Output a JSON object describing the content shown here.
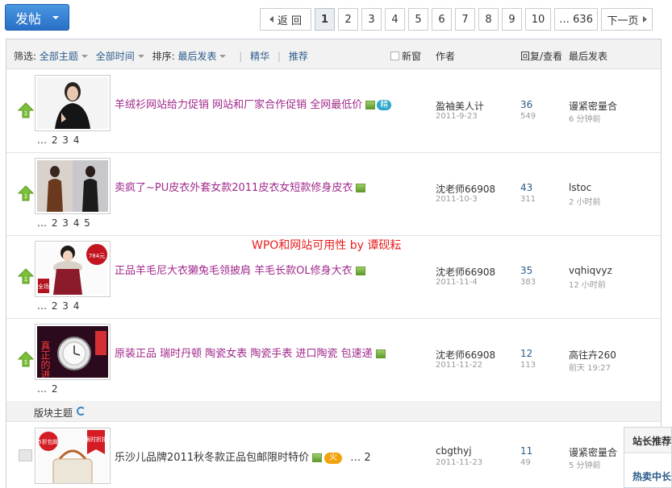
{
  "toolbar": {
    "post_label": "发帖"
  },
  "pager": {
    "back": "返 回",
    "pages": [
      "1",
      "2",
      "3",
      "4",
      "5",
      "6",
      "7",
      "8",
      "9",
      "10"
    ],
    "last": "… 636",
    "next": "下一页"
  },
  "header": {
    "filter_prefix": "筛选:",
    "all_topics": "全部主题",
    "all_time": "全部时间",
    "sort_prefix": "排序:",
    "sort_value": "最后发表",
    "digest": "精华",
    "recommend": "推荐",
    "new_window": "新窗",
    "col_author": "作者",
    "col_reply": "回复/查看",
    "col_last": "最后发表"
  },
  "threads": [
    {
      "title": "羊绒衫网站给力促销 网站和厂家合作促销 全网最低价",
      "digest_badge": "精",
      "pages": "… 2 3 4",
      "author": "盈袖美人计",
      "date": "2011-9-23",
      "replies": "36",
      "views": "549",
      "last_user": "谩紧密量合",
      "last_time": "6 分钟前"
    },
    {
      "title": "卖疯了~PU皮衣外套女款2011皮衣女短款修身皮衣",
      "pages": "… 2 3 4 5",
      "author": "沈老师66908",
      "date": "2011-10-3",
      "replies": "43",
      "views": "311",
      "last_user": "lstoc",
      "last_time": "2 小时前"
    },
    {
      "title": "正品羊毛尼大衣獭兔毛领披肩 羊毛长款OL修身大衣",
      "pages": "… 2 3 4",
      "author": "沈老师66908",
      "date": "2011-11-4",
      "replies": "35",
      "views": "383",
      "last_user": "vqhiqvyz",
      "last_time": "12 小时前",
      "thumb_price": "784元",
      "thumb_tag": "全场"
    },
    {
      "title": "原装正品 瑞时丹顿 陶瓷女表 陶瓷手表 进口陶瓷 包速递",
      "pages": "… 2",
      "author": "沈老师66908",
      "date": "2011-11-22",
      "replies": "12",
      "views": "113",
      "last_user": "高往卉260",
      "last_time": "前天 19:27",
      "thumb_text": "真正的进口"
    }
  ],
  "watermark": "WPO和网站可用性 by 谭砚耘",
  "section": {
    "label": "版块主题"
  },
  "board_thread": {
    "title": "乐沙儿品牌2011秋冬款正品包邮限时特价",
    "hot_badge": "火",
    "pages": "… 2",
    "author": "cbgthyj",
    "date": "2011-11-23",
    "replies": "11",
    "views": "49",
    "last_user": "谩紧密量合",
    "last_time": "5 分钟前",
    "thumb_discount": "5折包邮",
    "thumb_tag": "限时折扣"
  },
  "side_panel": {
    "title": "站长推荐",
    "item": "热卖中长"
  },
  "colors": {
    "accent": "#2b5b8a",
    "title": "#a0288c",
    "button": "#2870c6",
    "watermark": "#e81d1d"
  }
}
